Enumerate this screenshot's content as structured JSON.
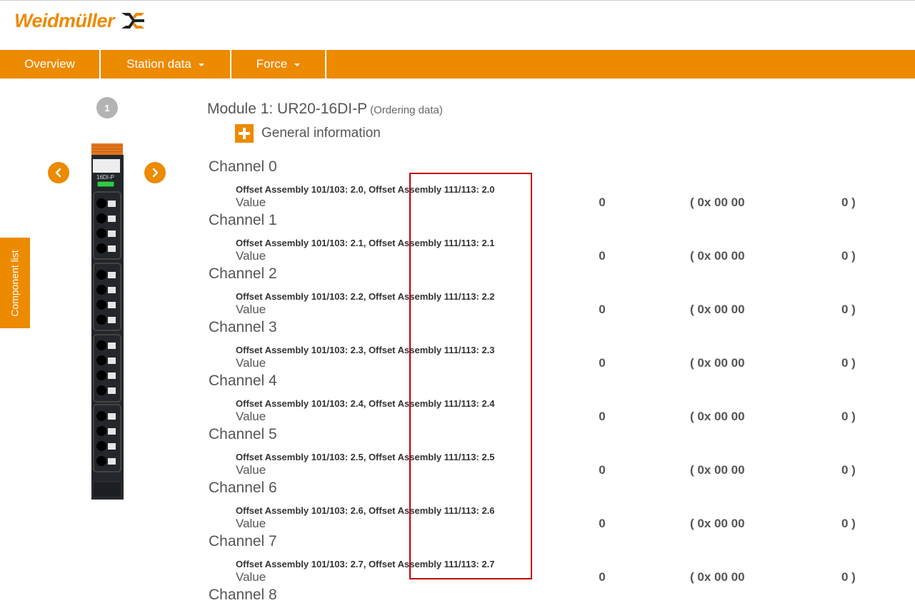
{
  "brand": {
    "name": "Weidmüller",
    "accent": "#ec8a00",
    "logo_icon": "weidmueller-wing-icon"
  },
  "nav": {
    "items": [
      {
        "label": "Overview",
        "dropdown": false
      },
      {
        "label": "Station data",
        "dropdown": true
      },
      {
        "label": "Force",
        "dropdown": true
      }
    ]
  },
  "side_tab": {
    "label": "Component list"
  },
  "module": {
    "index": "1",
    "device_label": "16DI-P",
    "title": "Module 1: UR20-16DI-P",
    "ordering_link": "(Ordering data)",
    "general_info": "General information"
  },
  "channels": [
    {
      "name": "Channel 0",
      "offset": "Offset Assembly 101/103: 2.0, Offset Assembly 111/113: 2.0",
      "label": "Value",
      "dec": "0",
      "hex": "( 0x 00 00",
      "bin": "0 )"
    },
    {
      "name": "Channel 1",
      "offset": "Offset Assembly 101/103: 2.1, Offset Assembly 111/113: 2.1",
      "label": "Value",
      "dec": "0",
      "hex": "( 0x 00 00",
      "bin": "0 )"
    },
    {
      "name": "Channel 2",
      "offset": "Offset Assembly 101/103: 2.2, Offset Assembly 111/113: 2.2",
      "label": "Value",
      "dec": "0",
      "hex": "( 0x 00 00",
      "bin": "0 )"
    },
    {
      "name": "Channel 3",
      "offset": "Offset Assembly 101/103: 2.3, Offset Assembly 111/113: 2.3",
      "label": "Value",
      "dec": "0",
      "hex": "( 0x 00 00",
      "bin": "0 )"
    },
    {
      "name": "Channel 4",
      "offset": "Offset Assembly 101/103: 2.4, Offset Assembly 111/113: 2.4",
      "label": "Value",
      "dec": "0",
      "hex": "( 0x 00 00",
      "bin": "0 )"
    },
    {
      "name": "Channel 5",
      "offset": "Offset Assembly 101/103: 2.5, Offset Assembly 111/113: 2.5",
      "label": "Value",
      "dec": "0",
      "hex": "( 0x 00 00",
      "bin": "0 )"
    },
    {
      "name": "Channel 6",
      "offset": "Offset Assembly 101/103: 2.6, Offset Assembly 111/113: 2.6",
      "label": "Value",
      "dec": "0",
      "hex": "( 0x 00 00",
      "bin": "0 )"
    },
    {
      "name": "Channel 7",
      "offset": "Offset Assembly 101/103: 2.7, Offset Assembly 111/113: 2.7",
      "label": "Value",
      "dec": "0",
      "hex": "( 0x 00 00",
      "bin": "0 )"
    },
    {
      "name": "Channel 8"
    }
  ]
}
